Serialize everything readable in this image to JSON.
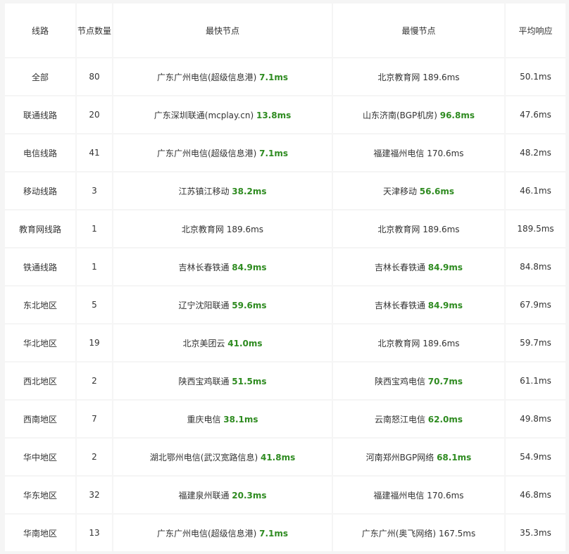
{
  "colors": {
    "good_latency": "#2e8b20",
    "text": "#333333",
    "grid": "#f5f5f5",
    "cell_bg": "#ffffff"
  },
  "headers": [
    "线路",
    "节点数量",
    "最快节点",
    "最慢节点",
    "平均响应"
  ],
  "rows": [
    {
      "line": "全部",
      "count": "80",
      "fast_node": "广东广州电信(超级信息港)",
      "fast_ms": "7.1ms",
      "fast_good": true,
      "slow_node": "北京教育网",
      "slow_ms": "189.6ms",
      "slow_good": false,
      "avg": "50.1ms"
    },
    {
      "line": "联通线路",
      "count": "20",
      "fast_node": "广东深圳联通(mcplay.cn)",
      "fast_ms": "13.8ms",
      "fast_good": true,
      "slow_node": "山东济南(BGP机房)",
      "slow_ms": "96.8ms",
      "slow_good": true,
      "avg": "47.6ms"
    },
    {
      "line": "电信线路",
      "count": "41",
      "fast_node": "广东广州电信(超级信息港)",
      "fast_ms": "7.1ms",
      "fast_good": true,
      "slow_node": "福建福州电信",
      "slow_ms": "170.6ms",
      "slow_good": false,
      "avg": "48.2ms"
    },
    {
      "line": "移动线路",
      "count": "3",
      "fast_node": "江苏镇江移动",
      "fast_ms": "38.2ms",
      "fast_good": true,
      "slow_node": "天津移动",
      "slow_ms": "56.6ms",
      "slow_good": true,
      "avg": "46.1ms"
    },
    {
      "line": "教育网线路",
      "count": "1",
      "fast_node": "北京教育网",
      "fast_ms": "189.6ms",
      "fast_good": false,
      "slow_node": "北京教育网",
      "slow_ms": "189.6ms",
      "slow_good": false,
      "avg": "189.5ms"
    },
    {
      "line": "铁通线路",
      "count": "1",
      "fast_node": "吉林长春铁通",
      "fast_ms": "84.9ms",
      "fast_good": true,
      "slow_node": "吉林长春铁通",
      "slow_ms": "84.9ms",
      "slow_good": true,
      "avg": "84.8ms"
    },
    {
      "line": "东北地区",
      "count": "5",
      "fast_node": "辽宁沈阳联通",
      "fast_ms": "59.6ms",
      "fast_good": true,
      "slow_node": "吉林长春铁通",
      "slow_ms": "84.9ms",
      "slow_good": true,
      "avg": "67.9ms"
    },
    {
      "line": "华北地区",
      "count": "19",
      "fast_node": "北京美团云",
      "fast_ms": "41.0ms",
      "fast_good": true,
      "slow_node": "北京教育网",
      "slow_ms": "189.6ms",
      "slow_good": false,
      "avg": "59.7ms"
    },
    {
      "line": "西北地区",
      "count": "2",
      "fast_node": "陕西宝鸡联通",
      "fast_ms": "51.5ms",
      "fast_good": true,
      "slow_node": "陕西宝鸡电信",
      "slow_ms": "70.7ms",
      "slow_good": true,
      "avg": "61.1ms"
    },
    {
      "line": "西南地区",
      "count": "7",
      "fast_node": "重庆电信",
      "fast_ms": "38.1ms",
      "fast_good": true,
      "slow_node": "云南怒江电信",
      "slow_ms": "62.0ms",
      "slow_good": true,
      "avg": "49.8ms"
    },
    {
      "line": "华中地区",
      "count": "2",
      "fast_node": "湖北鄂州电信(武汉宽路信息)",
      "fast_ms": "41.8ms",
      "fast_good": true,
      "slow_node": "河南郑州BGP网络",
      "slow_ms": "68.1ms",
      "slow_good": true,
      "avg": "54.9ms"
    },
    {
      "line": "华东地区",
      "count": "32",
      "fast_node": "福建泉州联通",
      "fast_ms": "20.3ms",
      "fast_good": true,
      "slow_node": "福建福州电信",
      "slow_ms": "170.6ms",
      "slow_good": false,
      "avg": "46.8ms"
    },
    {
      "line": "华南地区",
      "count": "13",
      "fast_node": "广东广州电信(超级信息港)",
      "fast_ms": "7.1ms",
      "fast_good": true,
      "slow_node": "广东广州(奥飞网络)",
      "slow_ms": "167.5ms",
      "slow_good": false,
      "avg": "35.3ms"
    }
  ]
}
